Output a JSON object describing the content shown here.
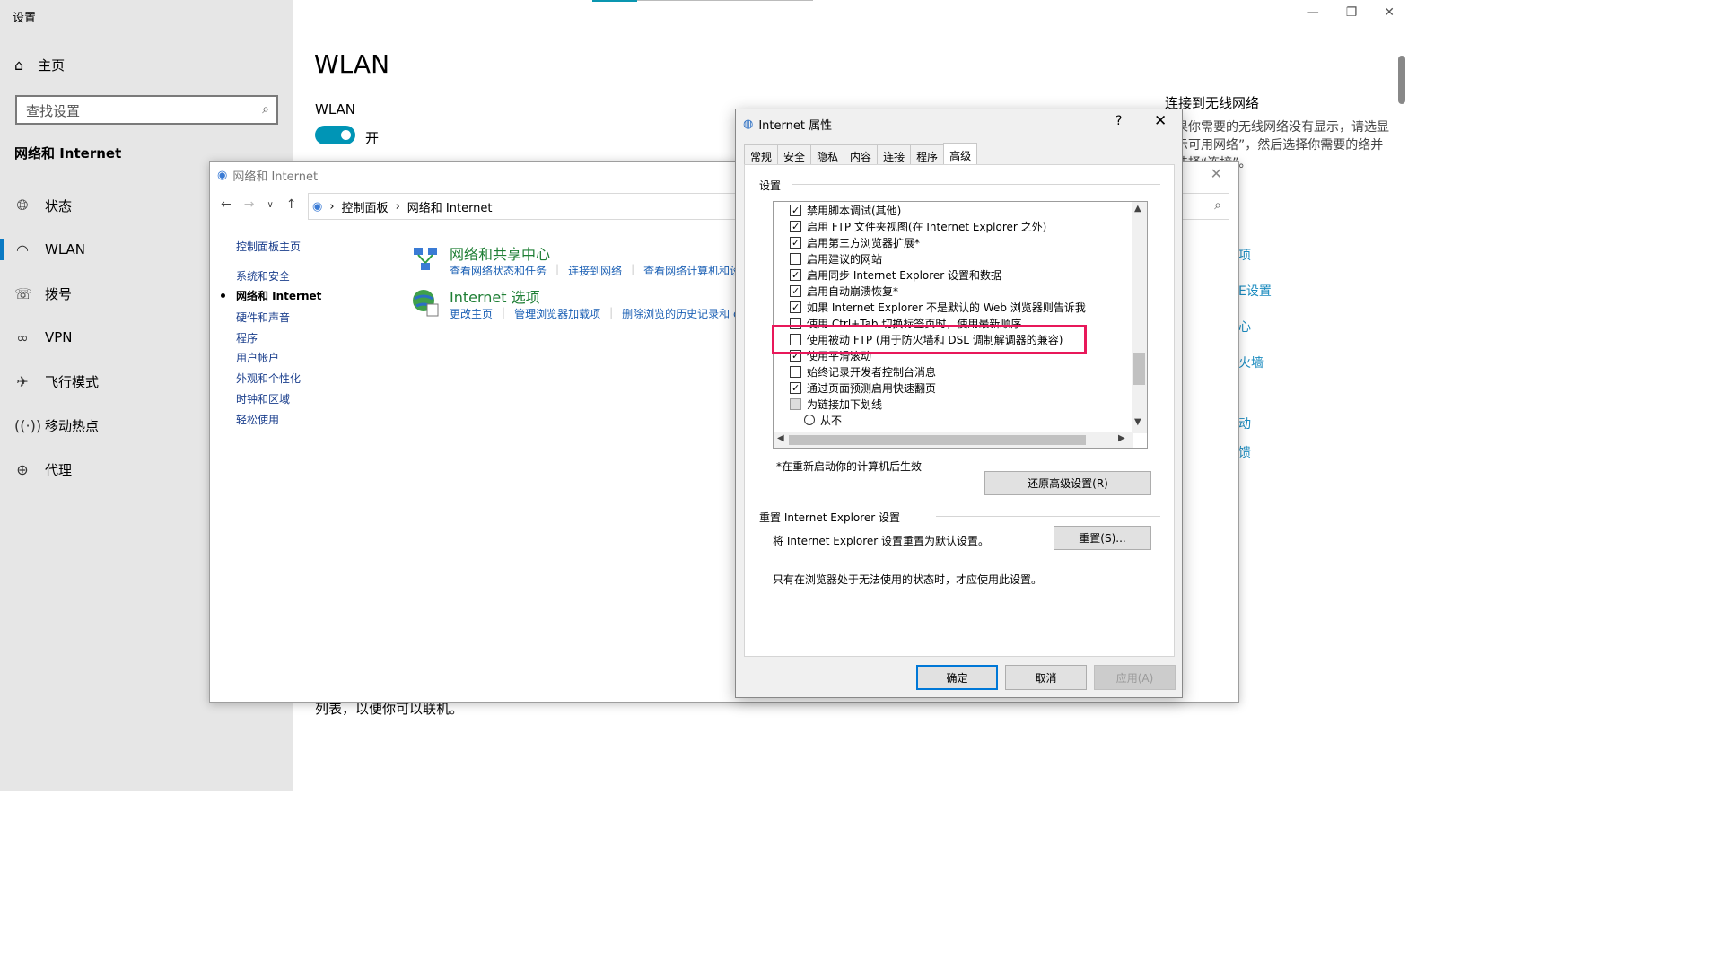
{
  "settings": {
    "app_title": "设置",
    "home_label": "主页",
    "search_placeholder": "查找设置",
    "section_title": "网络和 Internet",
    "nav": [
      {
        "label": "状态",
        "icon": "globe-icon"
      },
      {
        "label": "WLAN",
        "icon": "wifi-icon"
      },
      {
        "label": "拨号",
        "icon": "dialup-icon"
      },
      {
        "label": "VPN",
        "icon": "vpn-icon"
      },
      {
        "label": "飞行模式",
        "icon": "airplane-icon"
      },
      {
        "label": "移动热点",
        "icon": "hotspot-icon"
      },
      {
        "label": "代理",
        "icon": "proxy-globe-icon"
      }
    ],
    "page_heading": "WLAN",
    "wlan_label": "WLAN",
    "toggle_state": "开",
    "bottom_text": "列表，以便你可以联机。",
    "right_title": "连接到无线网络",
    "right_para": "果你需要的无线网络没有显示，请选显示可用网络”，然后选择你需要的络并选择“连接”。",
    "right_links": [
      "项",
      "E设置",
      "心",
      "火墙",
      "动",
      "馈"
    ]
  },
  "control_panel": {
    "title": "网络和 Internet",
    "breadcrumb": [
      "控制面板",
      "网络和 Internet"
    ],
    "sidebar": [
      "控制面板主页",
      "系统和安全",
      "网络和 Internet",
      "硬件和声音",
      "程序",
      "用户帐户",
      "外观和个性化",
      "时钟和区域",
      "轻松使用"
    ],
    "categories": [
      {
        "title": "网络和共享中心",
        "links": [
          "查看网络状态和任务",
          "连接到网络",
          "查看网络计算机和设"
        ]
      },
      {
        "title": "Internet 选项",
        "links": [
          "更改主页",
          "管理浏览器加载项",
          "删除浏览的历史记录和 c"
        ]
      }
    ]
  },
  "dialog": {
    "title": "Internet 属性",
    "help": "?",
    "tabs": [
      "常规",
      "安全",
      "隐私",
      "内容",
      "连接",
      "程序",
      "高级"
    ],
    "active_tab": "高级",
    "group_label": "设置",
    "settings_list": [
      {
        "label": "禁用脚本调试(其他)",
        "checked": true
      },
      {
        "label": "启用 FTP 文件夹视图(在 Internet Explorer 之外)",
        "checked": true
      },
      {
        "label": "启用第三方浏览器扩展*",
        "checked": true
      },
      {
        "label": "启用建议的网站",
        "checked": false
      },
      {
        "label": "启用同步 Internet Explorer 设置和数据",
        "checked": true
      },
      {
        "label": "启用自动崩溃恢复*",
        "checked": true
      },
      {
        "label": "如果 Internet Explorer 不是默认的 Web 浏览器则告诉我",
        "checked": true
      },
      {
        "label": "使用 Ctrl+Tab 切换标签页时，使用最新顺序",
        "checked": false
      },
      {
        "label": "使用被动 FTP (用于防火墙和 DSL 调制解调器的兼容)",
        "checked": false
      },
      {
        "label": "使用平滑滚动",
        "checked": true
      },
      {
        "label": "始终记录开发者控制台消息",
        "checked": false
      },
      {
        "label": "通过页面预测启用快速翻页",
        "checked": true
      },
      {
        "label": "为链接加下划线",
        "checked": false,
        "folder": true
      },
      {
        "label": "从不",
        "radio": true
      }
    ],
    "note": "*在重新启动你的计算机后生效",
    "restore_button": "还原高级设置(R)",
    "reset_title": "重置 Internet Explorer 设置",
    "reset_desc": "将 Internet Explorer 设置重置为默认设置。",
    "reset_button": "重置(S)...",
    "reset_warn": "只有在浏览器处于无法使用的状态时，才应使用此设置。",
    "ok": "确定",
    "cancel": "取消",
    "apply": "应用(A)"
  },
  "colors": {
    "highlight": "#e8185a",
    "toggle_on": "#0095b6",
    "link": "#1a5fb4",
    "category_title": "#1e7e34"
  }
}
